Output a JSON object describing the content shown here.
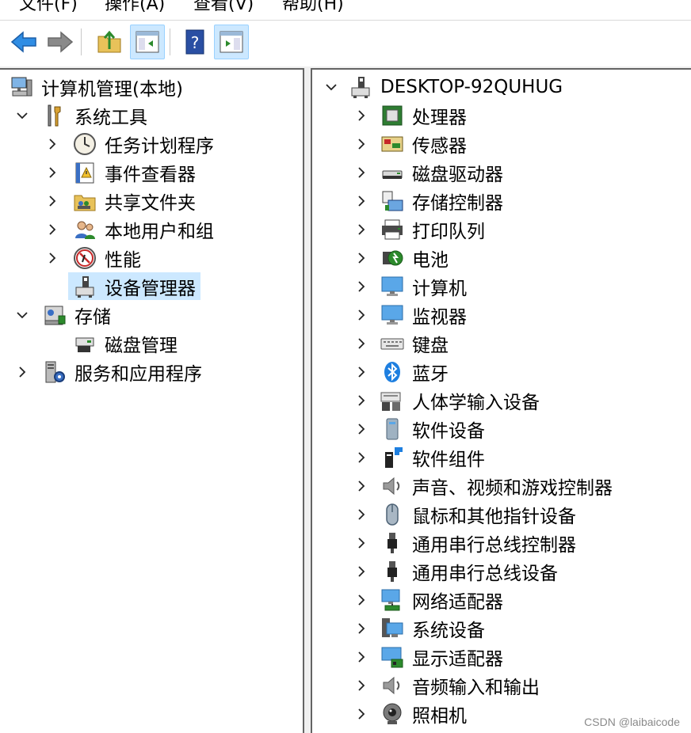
{
  "menu": [
    "文件(F)",
    "操作(A)",
    "查看(V)",
    "帮助(H)"
  ],
  "left_tree": {
    "root": "计算机管理(本地)",
    "system_tools": "系统工具",
    "system_children": [
      "任务计划程序",
      "事件查看器",
      "共享文件夹",
      "本地用户和组",
      "性能",
      "设备管理器"
    ],
    "storage": "存储",
    "storage_children": [
      "磁盘管理"
    ],
    "services": "服务和应用程序"
  },
  "device_tree": {
    "computer_name": "DESKTOP-92QUHUG",
    "categories": [
      {
        "label": "处理器",
        "icon": "processor-icon"
      },
      {
        "label": "传感器",
        "icon": "sensor-icon"
      },
      {
        "label": "磁盘驱动器",
        "icon": "disk-drive-icon"
      },
      {
        "label": "存储控制器",
        "icon": "storage-controller-icon"
      },
      {
        "label": "打印队列",
        "icon": "printer-icon"
      },
      {
        "label": "电池",
        "icon": "battery-icon"
      },
      {
        "label": "计算机",
        "icon": "computer-icon"
      },
      {
        "label": "监视器",
        "icon": "monitor-icon"
      },
      {
        "label": "键盘",
        "icon": "keyboard-icon"
      },
      {
        "label": "蓝牙",
        "icon": "bluetooth-icon"
      },
      {
        "label": "人体学输入设备",
        "icon": "hid-icon"
      },
      {
        "label": "软件设备",
        "icon": "software-device-icon"
      },
      {
        "label": "软件组件",
        "icon": "software-component-icon"
      },
      {
        "label": "声音、视频和游戏控制器",
        "icon": "speaker-icon"
      },
      {
        "label": "鼠标和其他指针设备",
        "icon": "mouse-icon"
      },
      {
        "label": "通用串行总线控制器",
        "icon": "usb-icon"
      },
      {
        "label": "通用串行总线设备",
        "icon": "usb-device-icon"
      },
      {
        "label": "网络适配器",
        "icon": "network-adapter-icon"
      },
      {
        "label": "系统设备",
        "icon": "system-device-icon"
      },
      {
        "label": "显示适配器",
        "icon": "display-adapter-icon"
      },
      {
        "label": "音频输入和输出",
        "icon": "audio-io-icon"
      },
      {
        "label": "照相机",
        "icon": "camera-icon"
      }
    ]
  },
  "watermark": "CSDN @laibaicode",
  "colors": {
    "selection": "#cce8ff",
    "accent_blue": "#2b88d8"
  }
}
